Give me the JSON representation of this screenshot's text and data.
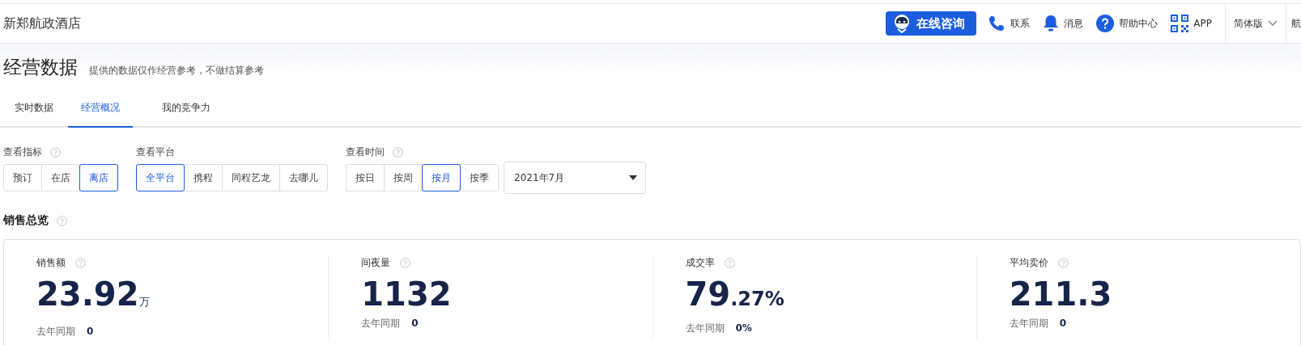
{
  "header": {
    "hotel_name": "新郑航政酒店",
    "consult_button": "在线咨询",
    "links": [
      {
        "kind": "phone",
        "label": "联系"
      },
      {
        "kind": "bell",
        "label": "消息"
      },
      {
        "kind": "help",
        "label": "帮助中心"
      },
      {
        "kind": "qr",
        "label": "APP"
      }
    ],
    "language": "简体版",
    "account": "航"
  },
  "page": {
    "title": "经营数据",
    "subtitle": "提供的数据仅作经营参考，不做结算参考"
  },
  "tabs": [
    {
      "label": "实时数据",
      "selected": false
    },
    {
      "label": "经营概况",
      "selected": true
    },
    {
      "label": "我的竞争力",
      "selected": false
    }
  ],
  "filters": [
    {
      "label": "查看指标",
      "help": true,
      "options": [
        {
          "label": "预订",
          "selected": false
        },
        {
          "label": "在店",
          "selected": false
        },
        {
          "label": "离店",
          "selected": true
        }
      ]
    },
    {
      "label": "查看平台",
      "help": false,
      "options": [
        {
          "label": "全平台",
          "selected": true
        },
        {
          "label": "携程",
          "selected": false
        },
        {
          "label": "同程艺龙",
          "selected": false
        },
        {
          "label": "去哪儿",
          "selected": false
        }
      ]
    },
    {
      "label": "查看时间",
      "help": true,
      "options": [
        {
          "label": "按日",
          "selected": false
        },
        {
          "label": "按周",
          "selected": false
        },
        {
          "label": "按月",
          "selected": true
        },
        {
          "label": "按季",
          "selected": false
        }
      ],
      "date": "2021年7月"
    }
  ],
  "sales_overview": {
    "title": "销售总览",
    "metrics": [
      {
        "label": "销售额",
        "value": "23.92",
        "value_small": "万",
        "last_year_label": "去年同期",
        "last_year": "0"
      },
      {
        "label": "间夜量",
        "value": "1132",
        "last_year_label": "去年同期",
        "last_year": "0"
      },
      {
        "label": "成交率",
        "value": "79",
        "value_small": ".27%",
        "last_year_label": "去年同期",
        "last_year": "0%"
      },
      {
        "label": "平均卖价",
        "value": "211.3",
        "last_year_label": "去年同期",
        "last_year": "0"
      }
    ]
  }
}
